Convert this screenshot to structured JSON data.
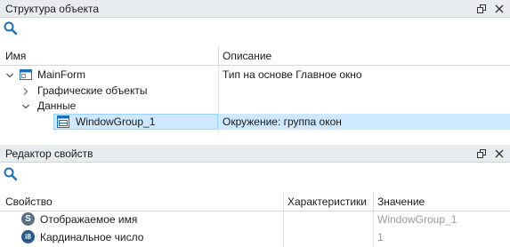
{
  "structure_panel": {
    "title": "Структура объекта",
    "col_name": "Имя",
    "col_desc": "Описание",
    "rows": [
      {
        "name": "MainForm",
        "desc": "Тип на основе Главное окно"
      },
      {
        "name": "Графические объекты",
        "desc": ""
      },
      {
        "name": "Данные",
        "desc": ""
      },
      {
        "name": "WindowGroup_1",
        "desc": "Окружение: группа окон"
      }
    ]
  },
  "props_panel": {
    "title": "Редактор свойств",
    "col_prop": "Свойство",
    "col_char": "Характеристики",
    "col_val": "Значение",
    "rows": [
      {
        "icon_letter": "S",
        "name": "Отображаемое имя",
        "value": "WindowGroup_1"
      },
      {
        "icon_letter": "i8",
        "name": "Кардинальное число",
        "value": "1"
      }
    ]
  },
  "icons": {
    "search": "search-icon",
    "float": "float-window-icon",
    "close": "close-icon"
  },
  "colors": {
    "header_bg": "#e9ecef",
    "selection": "#cde8ff",
    "selection_border": "#99d1ff",
    "accent_blue": "#1e6fb8",
    "dim_text": "#9a9a9a"
  }
}
